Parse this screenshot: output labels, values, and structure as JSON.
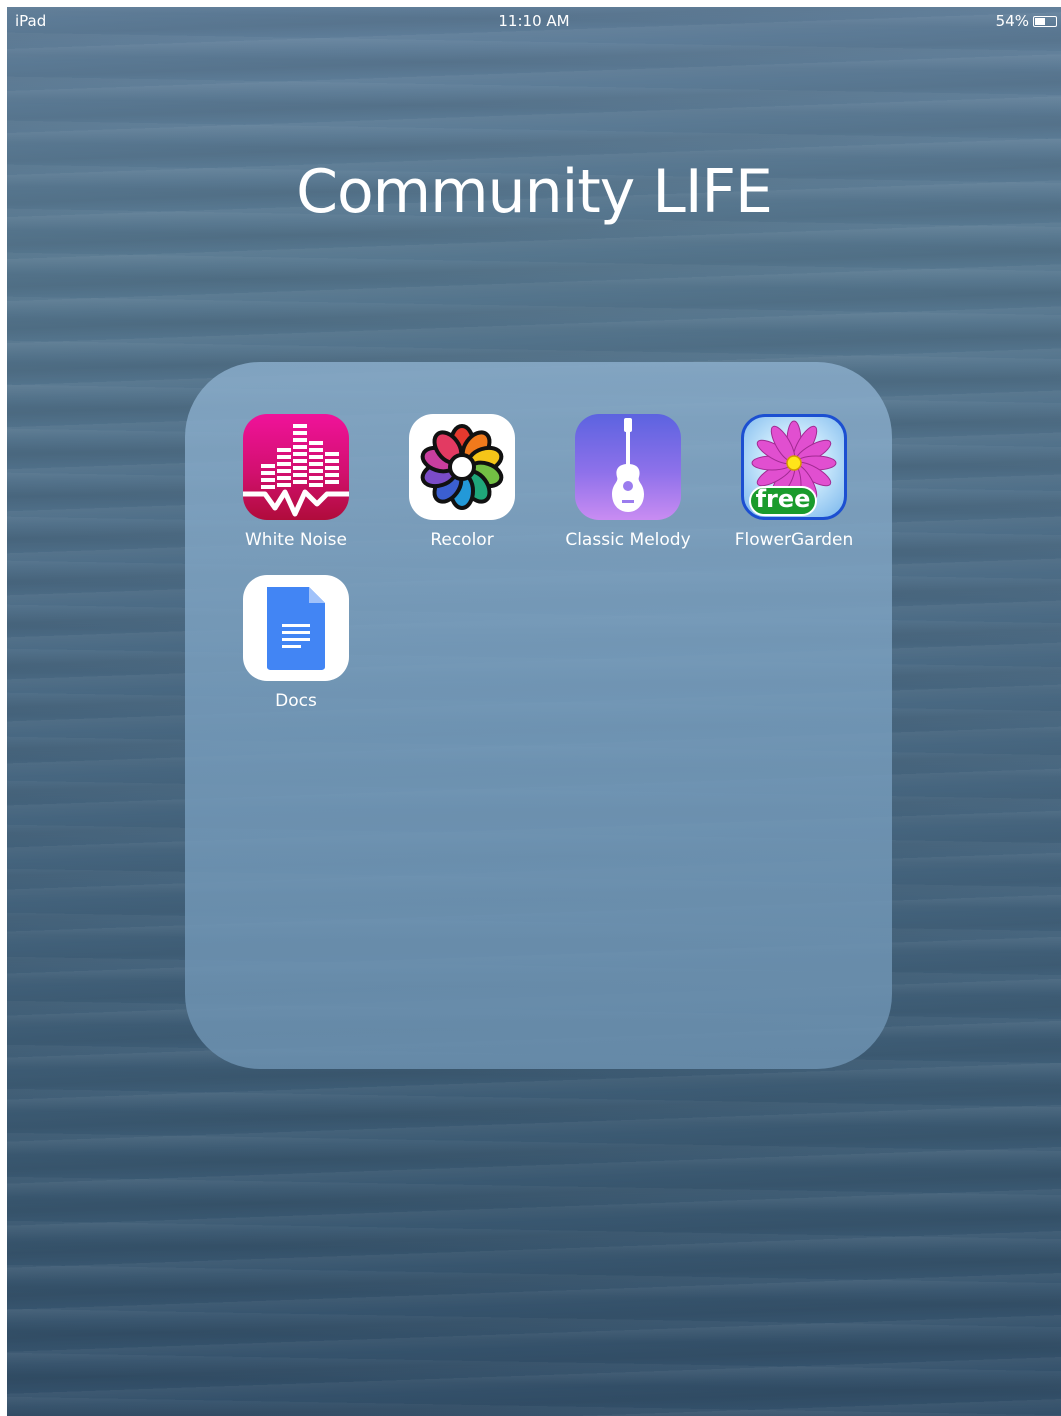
{
  "status_bar": {
    "device": "iPad",
    "time": "11:10 AM",
    "battery_percent": "54%",
    "battery_level": 0.54
  },
  "folder": {
    "title": "Community LIFE",
    "apps": [
      {
        "label": "White Noise",
        "icon": "white-noise-icon",
        "color": "#e0117f"
      },
      {
        "label": "Recolor",
        "icon": "recolor-icon",
        "color": "#ffffff"
      },
      {
        "label": "Classic Melody",
        "icon": "guitar-icon",
        "color": "#7a6ae6"
      },
      {
        "label": "FlowerGarden",
        "icon": "flower-garden-icon",
        "color": "#1c4fd1",
        "badge": "free"
      },
      {
        "label": "Docs",
        "icon": "docs-icon",
        "color": "#4285f4"
      }
    ]
  }
}
